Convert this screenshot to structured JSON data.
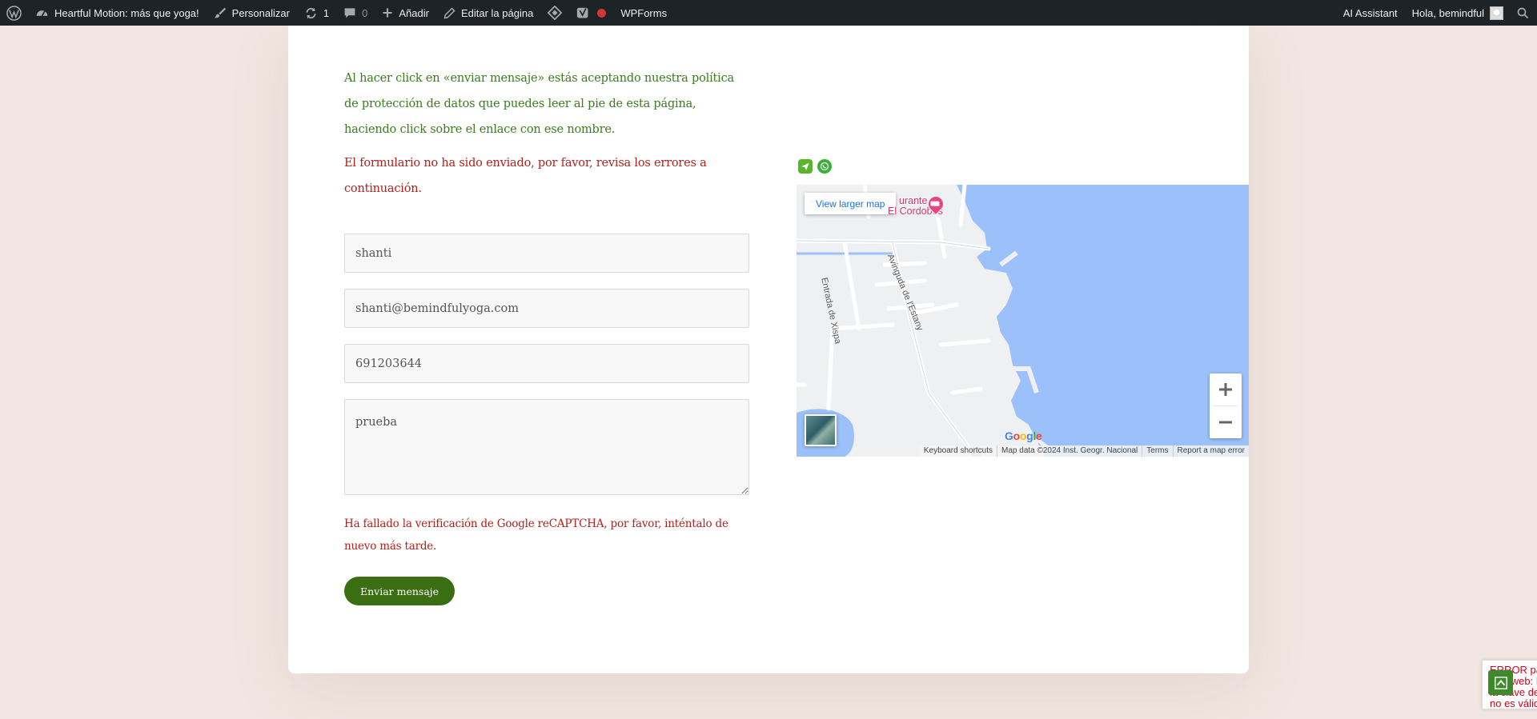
{
  "adminbar": {
    "site_name": "Heartful Motion: más que yoga!",
    "customize": "Personalizar",
    "updates_count": "1",
    "comments_count": "0",
    "add_new": "Añadir",
    "edit_page": "Editar la página",
    "wpforms": "WPForms",
    "ai_assistant": "AI Assistant",
    "greeting": "Hola, bemindful"
  },
  "form": {
    "consent_text": "Al hacer click en «enviar mensaje» estás aceptando nuestra política de protección de datos que puedes leer al pie de esta página, haciendo click sobre el enlace con ese nombre.",
    "error_text": "El formulario no ha sido enviado, por favor, revisa los errores a continuación.",
    "name_value": "shanti",
    "email_value": "shanti@bemindfulyoga.com",
    "phone_value": "691203644",
    "message_value": "prueba",
    "captcha_error": "Ha fallado la verificación de Google reCAPTCHA, por favor, inténtalo de nuevo más tarde.",
    "submit_label": "Enviar mensaje"
  },
  "map": {
    "view_larger": "View larger map",
    "poi_name_line1": "urante",
    "poi_name_line2": "El Cordobés",
    "street_1": "Entrada de Xispa",
    "street_2": "Avinguda de l'Estany",
    "keyboard_shortcuts": "Keyboard shortcuts",
    "map_data": "Map data ©2024 Inst. Geogr. Nacional",
    "terms": "Terms",
    "report": "Report a map error",
    "google_letters": [
      "G",
      "o",
      "o",
      "g",
      "l",
      "e"
    ],
    "google_colors": [
      "#4285f4",
      "#ea4335",
      "#fbbc05",
      "#4285f4",
      "#34a853",
      "#ea4335"
    ],
    "water_color": "#9cc0f9",
    "land_color": "#eef0f2"
  },
  "recaptcha_notice": "ERROR para el propietario del sitio web: Dominio no válido para la clave de sitio. el dominio web no es válido",
  "colors": {
    "consent_green": "#3d7a1e",
    "error_red": "#b0211c",
    "button_green": "#3b6e12",
    "adminbar_bg": "#1d2327",
    "page_bg": "#f1e6e1"
  }
}
